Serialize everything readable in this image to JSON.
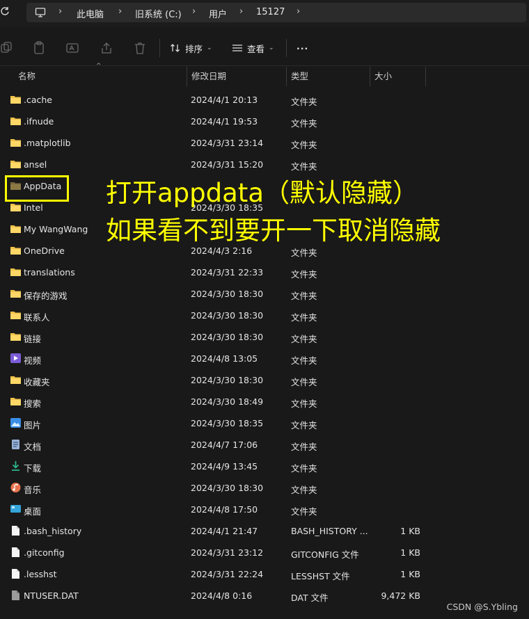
{
  "address": {
    "crumbs": [
      "此电脑",
      "旧系统 (C:)",
      "用户",
      "15127"
    ]
  },
  "toolbar": {
    "sort_label": "排序",
    "view_label": "查看",
    "more_label": "···"
  },
  "columns": {
    "name": "名称",
    "date": "修改日期",
    "type": "类型",
    "size": "大小"
  },
  "files": [
    {
      "name": ".cache",
      "date": "2024/4/1 20:13",
      "type": "文件夹",
      "size": "",
      "icon": "folder"
    },
    {
      "name": ".ifnude",
      "date": "2024/4/1 19:53",
      "type": "文件夹",
      "size": "",
      "icon": "folder"
    },
    {
      "name": ".matplotlib",
      "date": "2024/3/31 23:14",
      "type": "文件夹",
      "size": "",
      "icon": "folder"
    },
    {
      "name": "ansel",
      "date": "2024/3/31 15:20",
      "type": "文件夹",
      "size": "",
      "icon": "folder"
    },
    {
      "name": "AppData",
      "date": "",
      "type": "",
      "size": "",
      "icon": "folder-hidden"
    },
    {
      "name": "Intel",
      "date": "2024/3/30 18:35",
      "type": "",
      "size": "",
      "icon": "folder"
    },
    {
      "name": "My WangWang",
      "date": "",
      "type": "",
      "size": "",
      "icon": "folder"
    },
    {
      "name": "OneDrive",
      "date": "2024/4/3 2:16",
      "type": "文件夹",
      "size": "",
      "icon": "folder"
    },
    {
      "name": "translations",
      "date": "2024/3/31 22:33",
      "type": "文件夹",
      "size": "",
      "icon": "folder"
    },
    {
      "name": "保存的游戏",
      "date": "2024/3/30 18:30",
      "type": "文件夹",
      "size": "",
      "icon": "folder"
    },
    {
      "name": "联系人",
      "date": "2024/3/30 18:30",
      "type": "文件夹",
      "size": "",
      "icon": "folder"
    },
    {
      "name": "链接",
      "date": "2024/3/30 18:30",
      "type": "文件夹",
      "size": "",
      "icon": "folder"
    },
    {
      "name": "视频",
      "date": "2024/4/8 13:05",
      "type": "文件夹",
      "size": "",
      "icon": "video"
    },
    {
      "name": "收藏夹",
      "date": "2024/3/30 18:30",
      "type": "文件夹",
      "size": "",
      "icon": "folder"
    },
    {
      "name": "搜索",
      "date": "2024/3/30 18:49",
      "type": "文件夹",
      "size": "",
      "icon": "folder"
    },
    {
      "name": "图片",
      "date": "2024/3/30 18:35",
      "type": "文件夹",
      "size": "",
      "icon": "pictures"
    },
    {
      "name": "文档",
      "date": "2024/4/7 17:06",
      "type": "文件夹",
      "size": "",
      "icon": "documents"
    },
    {
      "name": "下载",
      "date": "2024/4/9 13:45",
      "type": "文件夹",
      "size": "",
      "icon": "download"
    },
    {
      "name": "音乐",
      "date": "2024/3/30 18:30",
      "type": "文件夹",
      "size": "",
      "icon": "music"
    },
    {
      "name": "桌面",
      "date": "2024/4/8 17:50",
      "type": "文件夹",
      "size": "",
      "icon": "desktop"
    },
    {
      "name": ".bash_history",
      "date": "2024/4/1 21:47",
      "type": "BASH_HISTORY ...",
      "size": "1 KB",
      "icon": "file"
    },
    {
      "name": ".gitconfig",
      "date": "2024/3/31 23:12",
      "type": "GITCONFIG 文件",
      "size": "1 KB",
      "icon": "file"
    },
    {
      "name": ".lesshst",
      "date": "2024/3/31 22:24",
      "type": "LESSHST 文件",
      "size": "1 KB",
      "icon": "file"
    },
    {
      "name": "NTUSER.DAT",
      "date": "2024/4/8 0:16",
      "type": "DAT 文件",
      "size": "9,472 KB",
      "icon": "file-gray"
    }
  ],
  "annotation": {
    "line1": "打开appdata（默认隐藏）",
    "line2": "如果看不到要开一下取消隐藏"
  },
  "watermark": "CSDN @S.Ybling",
  "colors": {
    "highlight": "#ffff00",
    "folder": "#f0c24b",
    "background": "#191919"
  }
}
